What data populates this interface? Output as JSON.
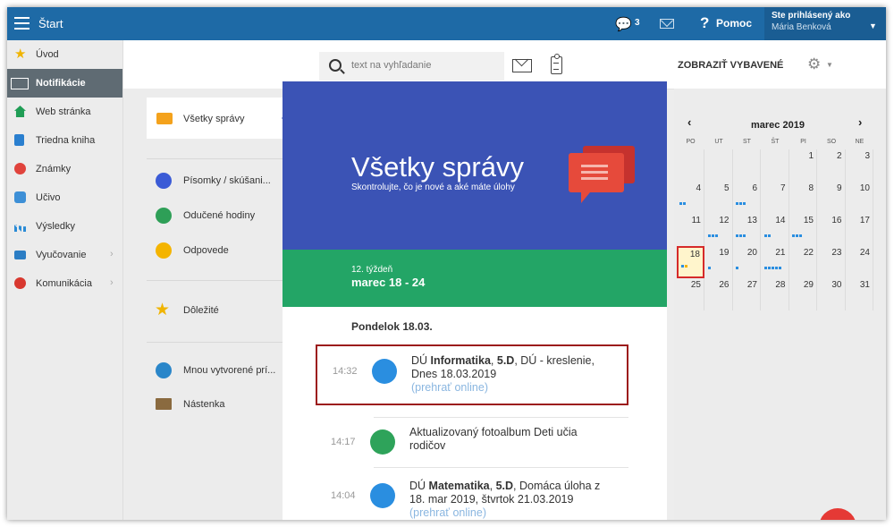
{
  "header": {
    "title": "Štart",
    "chat_count": "3",
    "help_label": "Pomoc",
    "user_title": "Ste prihlásený ako",
    "user_name": "Mária Benková"
  },
  "sidebar": {
    "items": [
      {
        "label": "Úvod",
        "icon": "star-icon",
        "color": "#f0b400",
        "active": false,
        "chevron": false
      },
      {
        "label": "Notifikácie",
        "icon": "envelope-icon",
        "color": "#ffffff",
        "active": true,
        "chevron": false
      },
      {
        "label": "Web stránka",
        "icon": "home-icon",
        "color": "#1f9d55",
        "active": false,
        "chevron": false
      },
      {
        "label": "Triedna kniha",
        "icon": "book-icon",
        "color": "#2a7fcf",
        "active": false,
        "chevron": false
      },
      {
        "label": "Známky",
        "icon": "grade-icon",
        "color": "#e0433c",
        "active": false,
        "chevron": false
      },
      {
        "label": "Učivo",
        "icon": "teacher-icon",
        "color": "#3d8fd6",
        "active": false,
        "chevron": false
      },
      {
        "label": "Výsledky",
        "icon": "bar-chart-icon",
        "color": "#2a8bd6",
        "active": false,
        "chevron": false
      },
      {
        "label": "Vyučovanie",
        "icon": "classroom-icon",
        "color": "#2b7dc4",
        "active": false,
        "chevron": true
      },
      {
        "label": "Komunikácia",
        "icon": "chat-bubbles-icon",
        "color": "#d8382f",
        "active": false,
        "chevron": true
      }
    ]
  },
  "toolbar": {
    "search_placeholder": "text na vyhľadanie",
    "show_equipped": "ZOBRAZIŤ VYBAVENÉ"
  },
  "categories": {
    "all": "Všetky správy",
    "group1": [
      {
        "label": "Písomky / skúšani...",
        "icon": "test-icon",
        "color": "#3b5bd6"
      },
      {
        "label": "Odučené hodiny",
        "icon": "lesson-icon",
        "color": "#2e9f57"
      },
      {
        "label": "Odpovede",
        "icon": "answers-icon",
        "color": "#f4b400"
      }
    ],
    "important": "Dôležité",
    "group3": [
      {
        "label": "Mnou vytvorené prí...",
        "icon": "created-icon",
        "color": "#2a86c9"
      },
      {
        "label": "Nástenka",
        "icon": "board-icon",
        "color": "#8a6a3f"
      }
    ]
  },
  "hero": {
    "title": "Všetky správy",
    "subtitle": "Skontrolujte, čo je nové a aké máte úlohy",
    "color": "#3b53b5"
  },
  "week": {
    "number": "12. týždeň",
    "range": "marec 18 - 24",
    "color": "#23a566"
  },
  "feed": {
    "day": "Pondelok 18.03.",
    "messages": [
      {
        "time": "14:32",
        "icon": "homework-icon",
        "color": "#2a8ee0",
        "pre": "DÚ ",
        "bold1": "Informatika",
        "mid": ", ",
        "bold2": "5.D",
        "rest": ", DÚ - kreslenie, Dnes 18.03.2019",
        "link": "(prehrať online)"
      },
      {
        "time": "14:17",
        "icon": "photo-album-icon",
        "color": "#2ea35a",
        "text": "Aktualizovaný fotoalbum Deti učia rodičov"
      },
      {
        "time": "14:04",
        "icon": "homework-icon",
        "color": "#2a8ee0",
        "pre": "DÚ ",
        "bold1": "Matematika",
        "mid": ", ",
        "bold2": "5.D",
        "rest": ", Domáca úloha z 18. mar 2019, štvrtok 21.03.2019",
        "link": "(prehrať online)"
      }
    ]
  },
  "calendar": {
    "month": "marec 2019",
    "prev": "‹",
    "next": "›",
    "weekdays": [
      "PO",
      "UT",
      "ST",
      "ŠT",
      "PI",
      "SO",
      "NE"
    ],
    "weeks": [
      [
        "",
        "",
        "",
        "",
        "1",
        "2",
        "3"
      ],
      [
        "4",
        "5",
        "6",
        "7",
        "8",
        "9",
        "10"
      ],
      [
        "11",
        "12",
        "13",
        "14",
        "15",
        "16",
        "17"
      ],
      [
        "18",
        "19",
        "20",
        "21",
        "22",
        "23",
        "24"
      ],
      [
        "25",
        "26",
        "27",
        "28",
        "29",
        "30",
        "31"
      ]
    ],
    "today": "18",
    "event_dot_colors": [
      "#2a8ee0",
      "#f4b400"
    ]
  }
}
